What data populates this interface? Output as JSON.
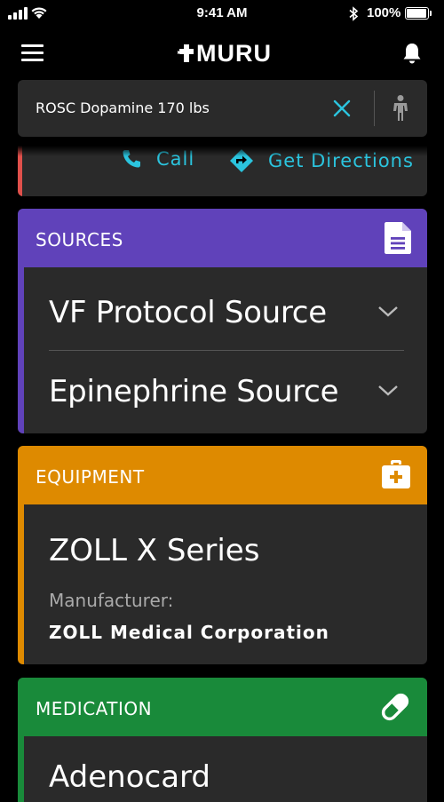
{
  "status_bar": {
    "time": "9:41 AM",
    "battery": "100%"
  },
  "header": {
    "logo": "MURU",
    "icons": [
      "menu-icon",
      "bell-icon"
    ]
  },
  "search": {
    "query": "ROSC Dopamine 170 lbs",
    "icons": [
      "clear-icon",
      "person-icon"
    ]
  },
  "contact_card": {
    "call_label": "Call",
    "directions_label": "Get Directions"
  },
  "sources": {
    "title": "SOURCES",
    "items": [
      {
        "label": "VF Protocol Source"
      },
      {
        "label": "Epinephrine Source"
      }
    ]
  },
  "equipment": {
    "title": "EQUIPMENT",
    "name": "ZOLL X Series",
    "manufacturer_label": "Manufacturer:",
    "manufacturer": "ZOLL Medical Corporation"
  },
  "medication": {
    "title": "MEDICATION",
    "name": "Adenocard"
  },
  "colors": {
    "sources": "#6042ba",
    "equipment": "#de8a00",
    "medication": "#198a3a",
    "link": "#2bc4de",
    "contact_accent": "#e0504b"
  }
}
